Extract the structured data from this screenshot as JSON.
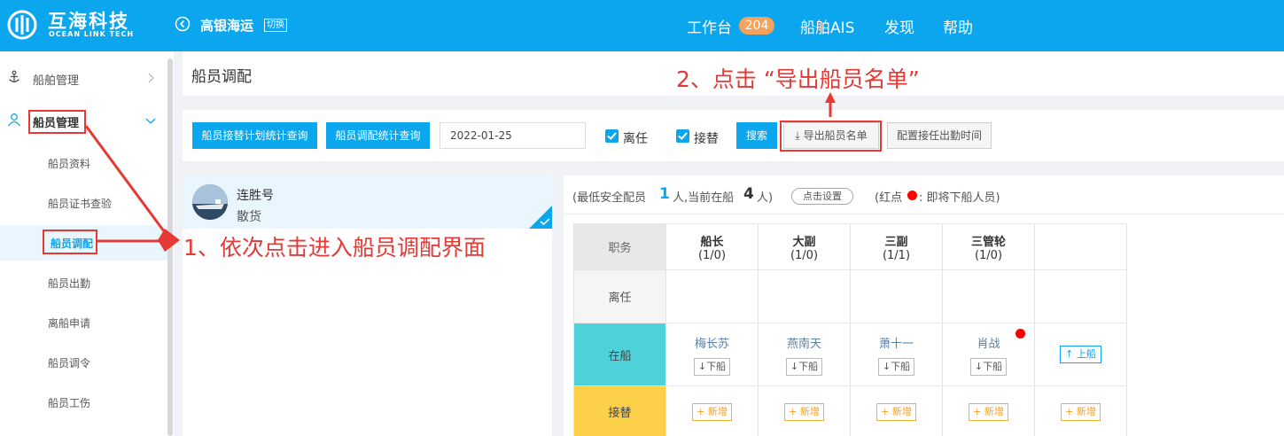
{
  "header": {
    "logo_cn": "互海科技",
    "logo_en": "OCEAN LINK TECH",
    "company": "高银海运",
    "switch_label": "切换",
    "nav": [
      {
        "label": "工作台",
        "badge": "204"
      },
      {
        "label": "船舶AIS"
      },
      {
        "label": "发现"
      },
      {
        "label": "帮助"
      }
    ]
  },
  "sidebar": {
    "groups": [
      {
        "label": "船舶管理"
      },
      {
        "label": "船员管理"
      }
    ],
    "items": [
      {
        "label": "船员资料"
      },
      {
        "label": "船员证书查验"
      },
      {
        "label": "船员调配"
      },
      {
        "label": "船员出勤"
      },
      {
        "label": "离船申请"
      },
      {
        "label": "船员调令"
      },
      {
        "label": "船员工伤"
      }
    ]
  },
  "page": {
    "title": "船员调配"
  },
  "toolbar": {
    "btn_plan_stats": "船员接替计划统计查询",
    "btn_deploy_stats": "船员调配统计查询",
    "date_value": "2022-01-25",
    "check_leave": "离任",
    "check_relieve": "接替",
    "btn_search": "搜索",
    "btn_export": "导出船员名单",
    "btn_config": "配置接任出勤时间"
  },
  "ship": {
    "name": "连胜号",
    "type": "散货"
  },
  "crew_info": {
    "prefix": "(最低安全配员",
    "min_count": "1",
    "mid": "人,当前在船",
    "onboard_count": "4",
    "suffix": "人)",
    "set_button": "点击设置",
    "legend_prefix": "(红点",
    "legend_suffix": ":  即将下船人员)"
  },
  "table": {
    "header_label": "职务",
    "rows": {
      "leave": "离任",
      "onboard": "在船",
      "relieve": "接替"
    },
    "positions": [
      {
        "title": "船长",
        "count": "(1/0)",
        "crew": "梅长苏"
      },
      {
        "title": "大副",
        "count": "(1/0)",
        "crew": "燕南天"
      },
      {
        "title": "三副",
        "count": "(1/1)",
        "crew": "萧十一"
      },
      {
        "title": "三管轮",
        "count": "(1/0)",
        "crew": "肖战"
      }
    ],
    "down_label": "下船",
    "add_label": "新增",
    "board_label": "上船"
  },
  "annotations": {
    "step1": "1、依次点击进入船员调配界面",
    "step2": "2、点击 “导出船员名单”"
  },
  "colors": {
    "primary": "#0ba6ee",
    "annotation": "#e53935",
    "onboard_row": "#4fd1d9",
    "relieve_row": "#fcd049",
    "badge": "#f5a25d"
  }
}
